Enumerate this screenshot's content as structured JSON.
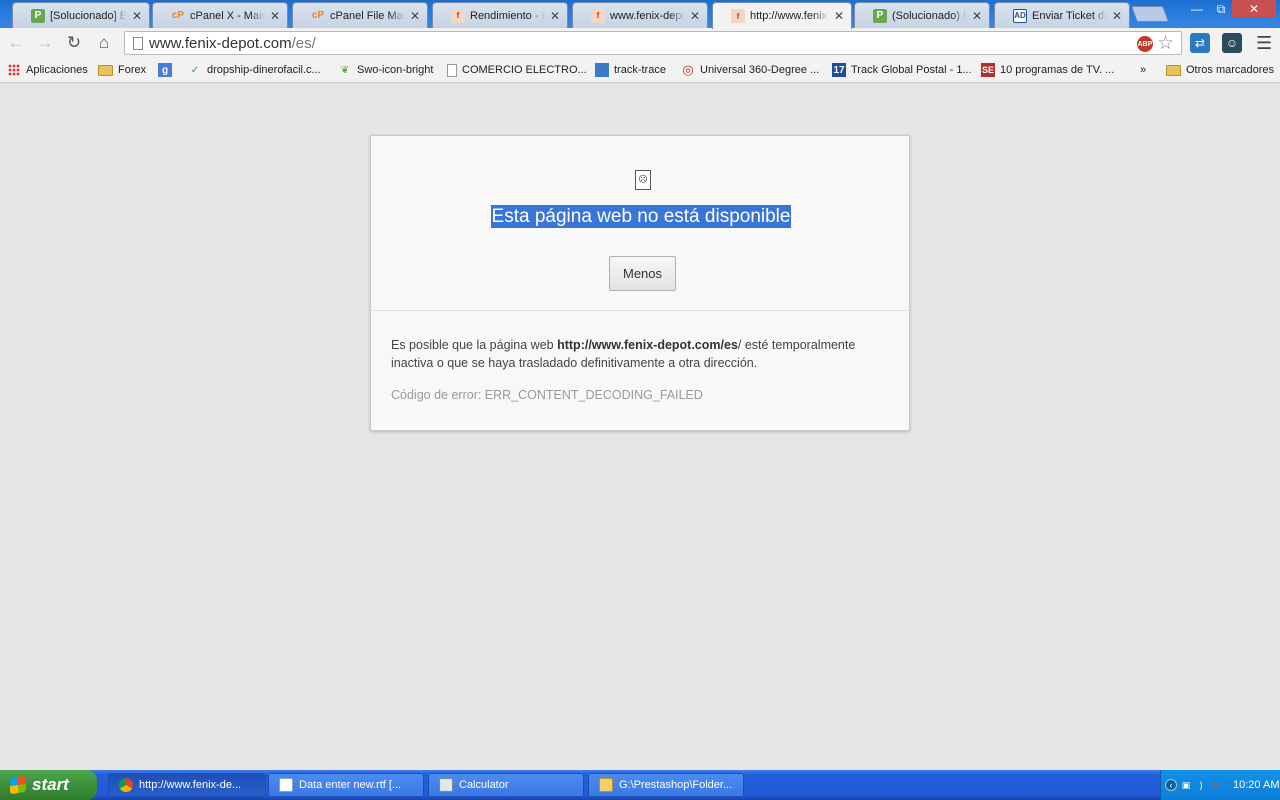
{
  "tabs": [
    {
      "title": "[Solucionado] Error",
      "icon": "prestashop-icon"
    },
    {
      "title": "cPanel X - Main",
      "icon": "cpanel-icon"
    },
    {
      "title": "cPanel File Manager",
      "icon": "cpanel-icon"
    },
    {
      "title": "Rendimiento - Presta",
      "icon": "fenix-icon"
    },
    {
      "title": "www.fenix-depot",
      "icon": "fenix-icon"
    },
    {
      "title": "http://www.fenix-depot",
      "icon": "fenix-icon",
      "active": true
    },
    {
      "title": "(Solucionado) Error",
      "icon": "prestashop-icon"
    },
    {
      "title": "Enviar Ticket de C",
      "icon": "ad-icon"
    }
  ],
  "window_controls": {
    "minimize": "—",
    "restore": "⧉",
    "close": "✕"
  },
  "toolbar": {
    "url_host": "www.fenix-depot.com",
    "url_path": "/es/",
    "abp_label": "ABP"
  },
  "bookmarks": [
    {
      "label": "Aplicaciones"
    },
    {
      "label": "Forex"
    },
    {
      "label": ""
    },
    {
      "label": "dropship-dinerofacil.c..."
    },
    {
      "label": "Swo-icon-bright"
    },
    {
      "label": "COMERCIO ELECTRO..."
    },
    {
      "label": "track-trace"
    },
    {
      "label": "Universal 360-Degree ..."
    },
    {
      "label": "Track Global Postal - 1..."
    },
    {
      "label": "10 programas de TV. ..."
    }
  ],
  "bookmarks_overflow": "»",
  "bookmarks_other": "Otros marcadores",
  "error_page": {
    "headline": "Esta página web no está disponible",
    "button_label": "Menos",
    "details_prefix": "Es posible que la página web ",
    "details_url_bold": "http://www.fenix-depot.com/es",
    "details_suffix": "/ esté temporalmente inactiva o que se haya trasladado definitivamente a otra dirección.",
    "error_code": "Código de error: ERR_CONTENT_DECODING_FAILED"
  },
  "taskbar": {
    "start_label": "start",
    "buttons": [
      {
        "label": "http://www.fenix-de...",
        "active": true
      },
      {
        "label": "Data enter new.rtf [..."
      },
      {
        "label": "Calculator"
      },
      {
        "label": "G:\\Prestashop\\Folder..."
      }
    ],
    "clock": "10:20 AM"
  },
  "colors": {
    "selection": "#3875d7",
    "taskbar_blue": "#245edb",
    "start_green": "#3c8f3c",
    "page_bg": "#e5e5e5"
  }
}
